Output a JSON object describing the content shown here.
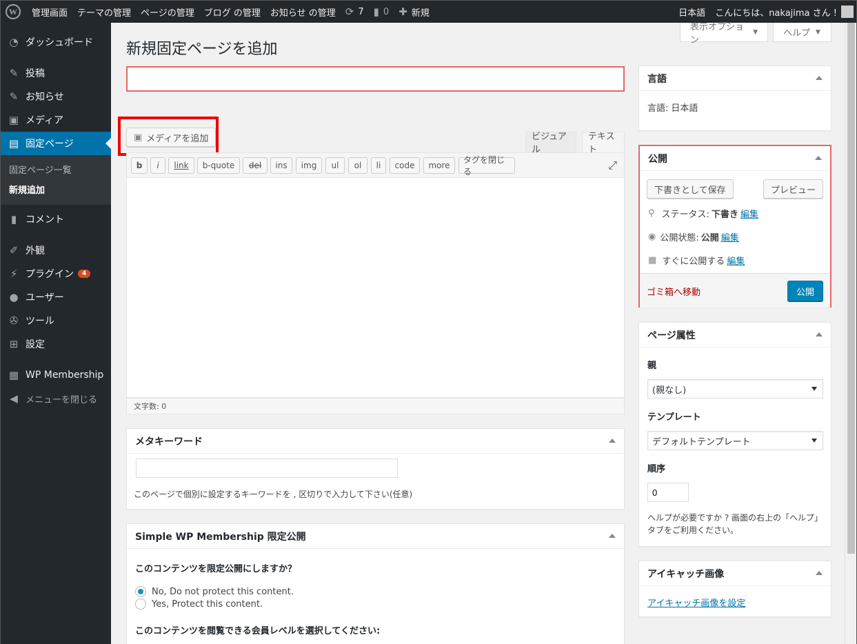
{
  "adminbar": {
    "site": "管理画面",
    "items": [
      "テーマの管理",
      "ページの管理",
      "ブログ の管理",
      "お知らせ の管理"
    ],
    "updates": "7",
    "comments": "0",
    "new": "新規",
    "lang": "日本語",
    "greeting": "こんにちは、nakajima さん !"
  },
  "sidebar": {
    "dashboard": "ダッシュボード",
    "posts": "投稿",
    "news": "お知らせ",
    "media": "メディア",
    "pages": "固定ページ",
    "sub_list": "固定ページ一覧",
    "sub_new": "新規追加",
    "comments": "コメント",
    "appearance": "外観",
    "plugins": "プラグイン",
    "plugins_badge": "4",
    "users": "ユーザー",
    "tools": "ツール",
    "settings": "設定",
    "membership": "WP Membership",
    "collapse": "メニューを閉じる"
  },
  "screen": {
    "options": "表示オプション",
    "help": "ヘルプ"
  },
  "page_title": "新規固定ページを追加",
  "title_value": "",
  "editor": {
    "add_media": "メディアを追加",
    "tab_visual": "ビジュアル",
    "tab_text": "テキスト",
    "quicktags": [
      "b",
      "i",
      "link",
      "b-quote",
      "del",
      "ins",
      "img",
      "ul",
      "ol",
      "li",
      "code",
      "more",
      "タグを閉じる"
    ],
    "word_count": "文字数: 0"
  },
  "meta_keyword": {
    "title": "メタキーワード",
    "value": "",
    "hint": "このページで個別に設定するキーワードを , 区切りで入力して下さい(任意)"
  },
  "swpm": {
    "title": "Simple WP Membership 限定公開",
    "question": "このコンテンツを限定公開にしますか？",
    "opt1": "No, Do not protect this content.",
    "opt2": "Yes, Protect this content.",
    "level": "このコンテンツを閲覧できる会員レベルを選択してください:"
  },
  "lang_box": {
    "title": "言語",
    "label": "言語:",
    "value": "日本語"
  },
  "publish": {
    "title": "公開",
    "save_draft": "下書きとして保存",
    "preview": "プレビュー",
    "status_label": "ステータス:",
    "status_value": "下書き",
    "visibility_label": "公開状態:",
    "visibility_value": "公開",
    "schedule": "すぐに公開する",
    "edit": "編集",
    "trash": "ゴミ箱へ移動",
    "publish_btn": "公開"
  },
  "attributes": {
    "title": "ページ属性",
    "parent_label": "親",
    "parent_value": "(親なし)",
    "template_label": "テンプレート",
    "template_value": "デフォルトテンプレート",
    "order_label": "順序",
    "order_value": "0",
    "help": "ヘルプが必要ですか ? 画面の右上の「ヘルプ」タブをご利用ください。"
  },
  "featured": {
    "title": "アイキャッチ画像",
    "link": "アイキャッチ画像を設定"
  },
  "colors": {
    "adminbar": "#23282d",
    "accent": "#0073aa",
    "highlight": "#e00000",
    "trash": "#a00"
  }
}
